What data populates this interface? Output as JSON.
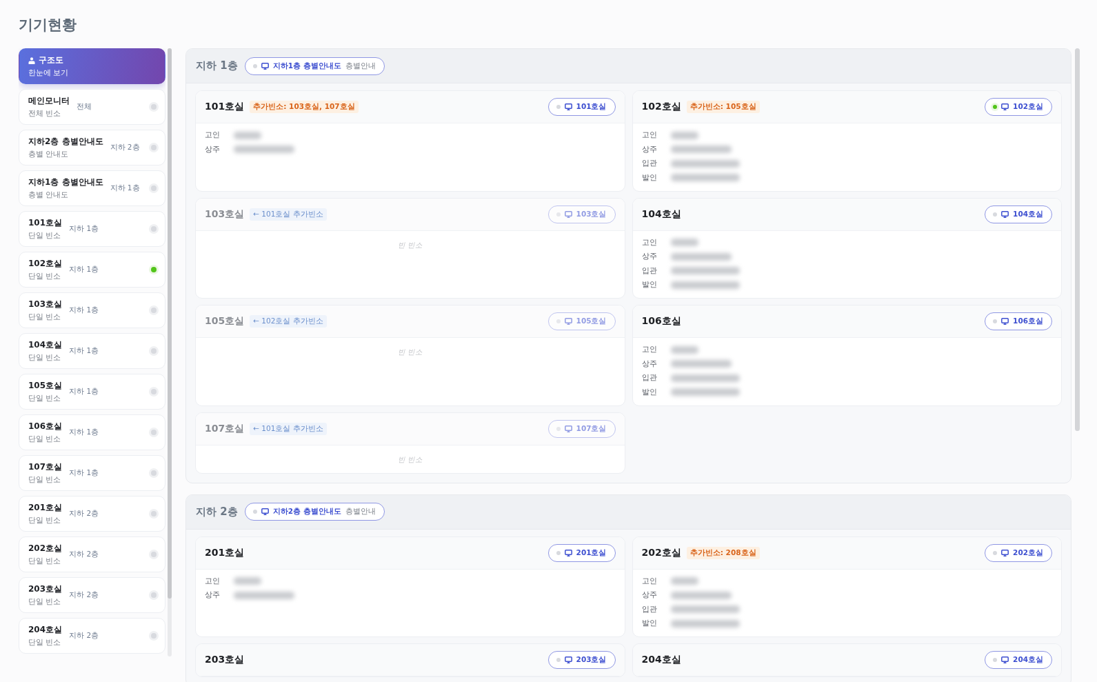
{
  "page": {
    "title": "기기현황"
  },
  "sidebar": {
    "header": {
      "title": "구조도",
      "subtitle": "한눈에 보기",
      "selected": true
    },
    "items": [
      {
        "name": "메인모니터",
        "subtitle": "전체 빈소",
        "floor": "전체",
        "online": false,
        "selected": false
      },
      {
        "name": "지하2층 층별안내도",
        "subtitle": "층별 안내도",
        "floor": "지하 2층",
        "online": false,
        "selected": false
      },
      {
        "name": "지하1층 층별안내도",
        "subtitle": "층별 안내도",
        "floor": "지하 1층",
        "online": false,
        "selected": false
      },
      {
        "name": "101호실",
        "subtitle": "단일 빈소",
        "floor": "지하 1층",
        "online": false,
        "selected": false
      },
      {
        "name": "102호실",
        "subtitle": "단일 빈소",
        "floor": "지하 1층",
        "online": true,
        "selected": false
      },
      {
        "name": "103호실",
        "subtitle": "단일 빈소",
        "floor": "지하 1층",
        "online": false,
        "selected": false
      },
      {
        "name": "104호실",
        "subtitle": "단일 빈소",
        "floor": "지하 1층",
        "online": false,
        "selected": false
      },
      {
        "name": "105호실",
        "subtitle": "단일 빈소",
        "floor": "지하 1층",
        "online": false,
        "selected": false
      },
      {
        "name": "106호실",
        "subtitle": "단일 빈소",
        "floor": "지하 1층",
        "online": false,
        "selected": false
      },
      {
        "name": "107호실",
        "subtitle": "단일 빈소",
        "floor": "지하 1층",
        "online": false,
        "selected": false
      },
      {
        "name": "201호실",
        "subtitle": "단일 빈소",
        "floor": "지하 2층",
        "online": false,
        "selected": false
      },
      {
        "name": "202호실",
        "subtitle": "단일 빈소",
        "floor": "지하 2층",
        "online": false,
        "selected": false
      },
      {
        "name": "203호실",
        "subtitle": "단일 빈소",
        "floor": "지하 2층",
        "online": false,
        "selected": false
      },
      {
        "name": "204호실",
        "subtitle": "단일 빈소",
        "floor": "지하 2층",
        "online": false,
        "selected": false
      }
    ]
  },
  "floors": [
    {
      "name": "지하 1층",
      "guide": {
        "label": "지하1층 층별안내도",
        "caption": "층별안내",
        "online": false
      },
      "rooms": [
        {
          "name": "101호실",
          "kind": "main",
          "tag": "추가빈소: 103호실, 107호실",
          "device": {
            "label": "101호실",
            "online": false
          },
          "fields": [
            "고인",
            "상주"
          ]
        },
        {
          "name": "102호실",
          "kind": "main",
          "tag": "추가빈소: 105호실",
          "device": {
            "label": "102호실",
            "online": true
          },
          "fields": [
            "고인",
            "상주",
            "입관",
            "발인"
          ]
        },
        {
          "name": "103호실",
          "kind": "linked",
          "tag": "← 101호실 추가빈소",
          "device": {
            "label": "103호실",
            "online": false
          },
          "empty_text": "빈 빈소"
        },
        {
          "name": "104호실",
          "kind": "main",
          "device": {
            "label": "104호실",
            "online": false
          },
          "fields": [
            "고인",
            "상주",
            "입관",
            "발인"
          ]
        },
        {
          "name": "105호실",
          "kind": "linked",
          "tag": "← 102호실 추가빈소",
          "device": {
            "label": "105호실",
            "online": false
          },
          "empty_text": "빈 빈소"
        },
        {
          "name": "106호실",
          "kind": "main",
          "device": {
            "label": "106호실",
            "online": false
          },
          "fields": [
            "고인",
            "상주",
            "입관",
            "발인"
          ]
        },
        {
          "name": "107호실",
          "kind": "linked",
          "tag": "← 101호실 추가빈소",
          "device": {
            "label": "107호실",
            "online": false
          },
          "empty_text": "빈 빈소"
        }
      ]
    },
    {
      "name": "지하 2층",
      "guide": {
        "label": "지하2층 층별안내도",
        "caption": "층별안내",
        "online": false
      },
      "rooms": [
        {
          "name": "201호실",
          "kind": "main",
          "device": {
            "label": "201호실",
            "online": false
          },
          "fields": [
            "고인",
            "상주"
          ]
        },
        {
          "name": "202호실",
          "kind": "main",
          "tag": "추가빈소: 208호실",
          "device": {
            "label": "202호실",
            "online": false
          },
          "fields": [
            "고인",
            "상주",
            "입관",
            "발인"
          ]
        },
        {
          "name": "203호실",
          "kind": "main",
          "device": {
            "label": "203호실",
            "online": false
          }
        },
        {
          "name": "204호실",
          "kind": "main",
          "device": {
            "label": "204호실",
            "online": false
          }
        }
      ]
    }
  ]
}
